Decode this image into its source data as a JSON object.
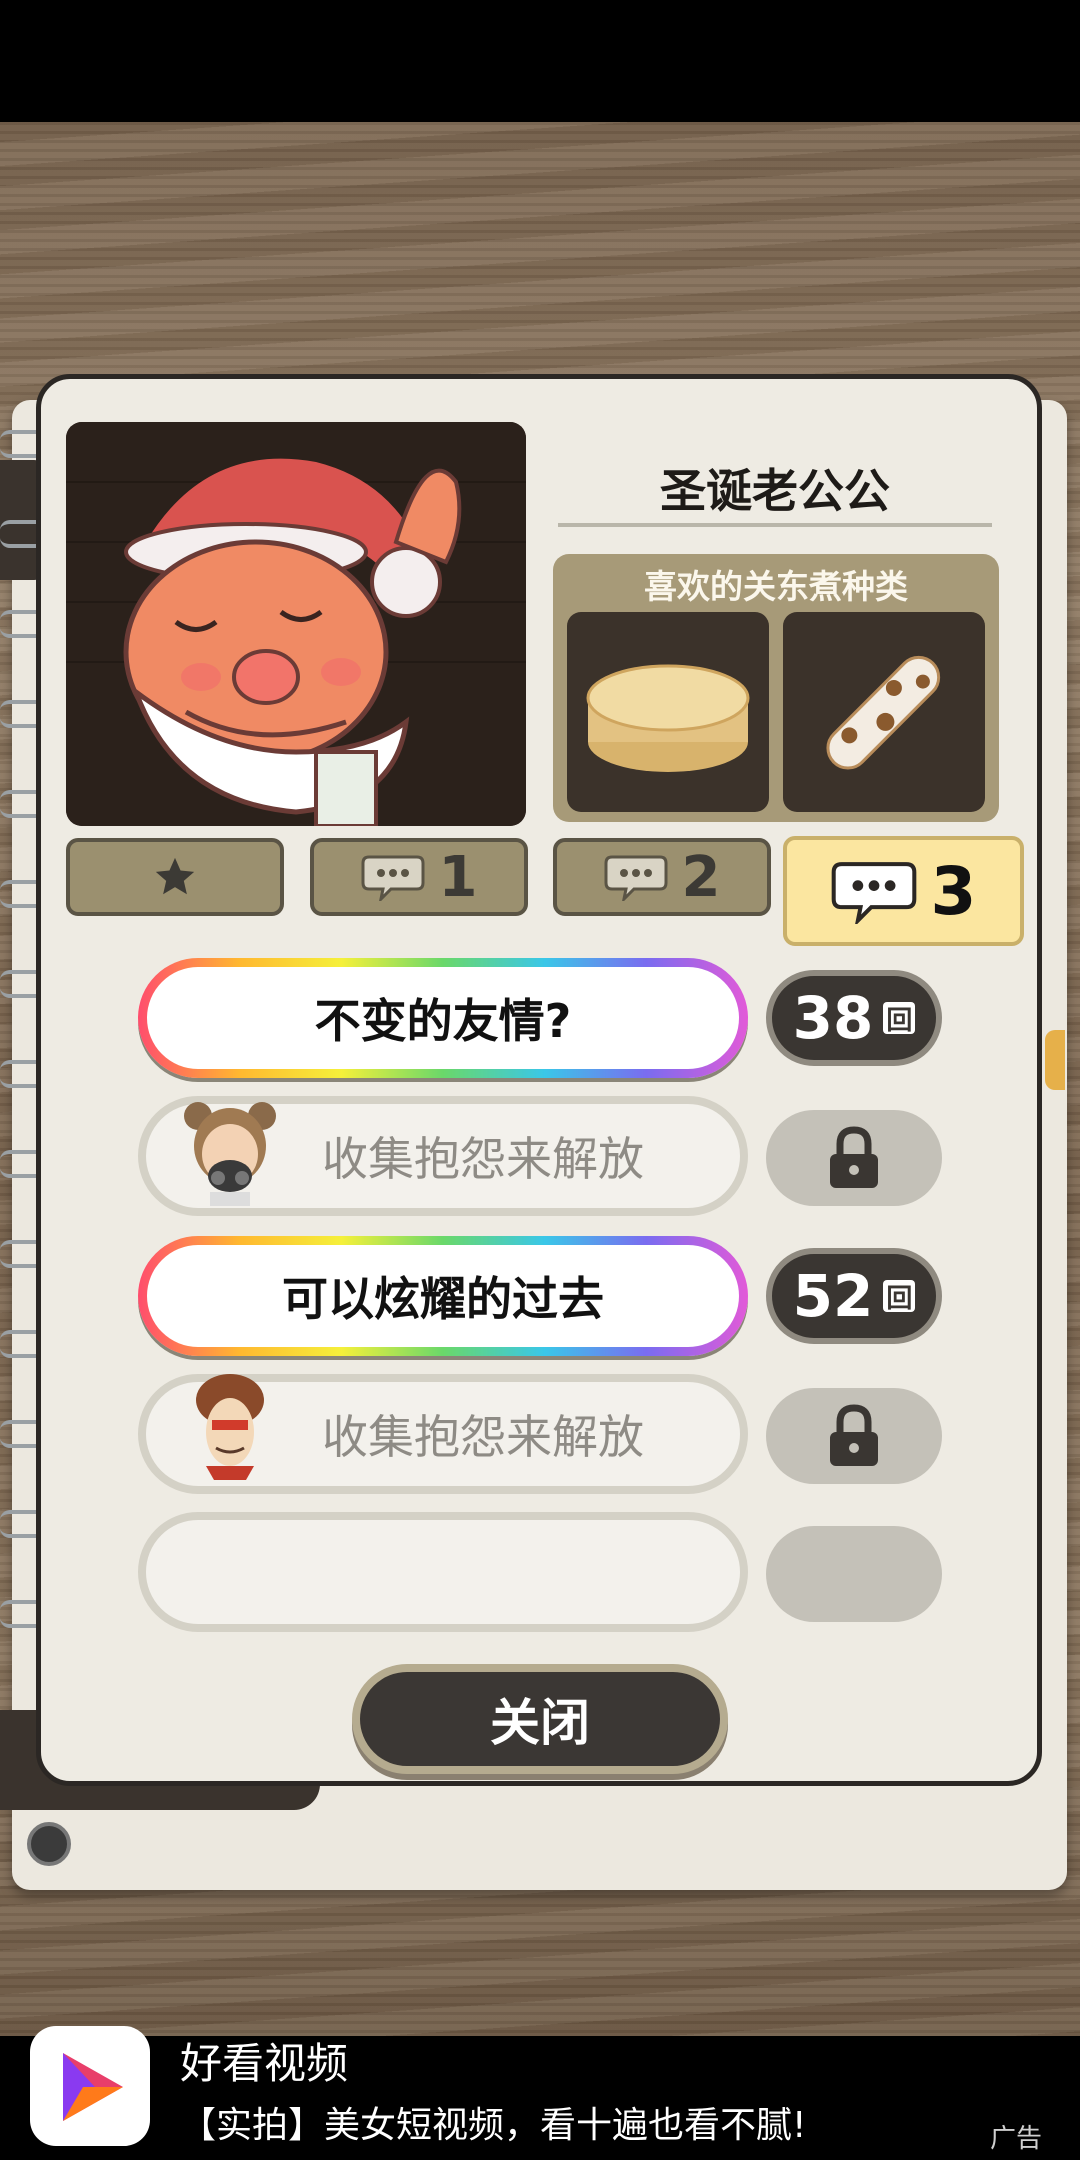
{
  "character": {
    "name": "圣诞老公公",
    "favorites_title": "喜欢的关东煮种类",
    "favorites": [
      "daikon",
      "chikuwa"
    ]
  },
  "tabs": [
    {
      "icon": "star-icon",
      "label": ""
    },
    {
      "icon": "speech-bubble-icon",
      "label": "1"
    },
    {
      "icon": "speech-bubble-icon",
      "label": "2"
    },
    {
      "icon": "speech-bubble-icon",
      "label": "3",
      "active": true
    }
  ],
  "stories": [
    {
      "title": "不变的友情?",
      "count": "38",
      "unit": "回",
      "locked": false
    },
    {
      "title": "收集抱怨来解放",
      "locked": true
    },
    {
      "title": "可以炫耀的过去",
      "count": "52",
      "unit": "回",
      "locked": false
    },
    {
      "title": "收集抱怨来解放",
      "locked": true
    },
    {
      "title": "",
      "empty": true
    }
  ],
  "close_label": "关闭",
  "ad": {
    "title": "好看视频",
    "description": "【实拍】美女短视频，看十遍也看不腻!",
    "label": "广告"
  },
  "colors": {
    "panel_bg": "#eeebe3",
    "active_tab": "#fbe6a0",
    "badge_dark": "#3a3632"
  }
}
